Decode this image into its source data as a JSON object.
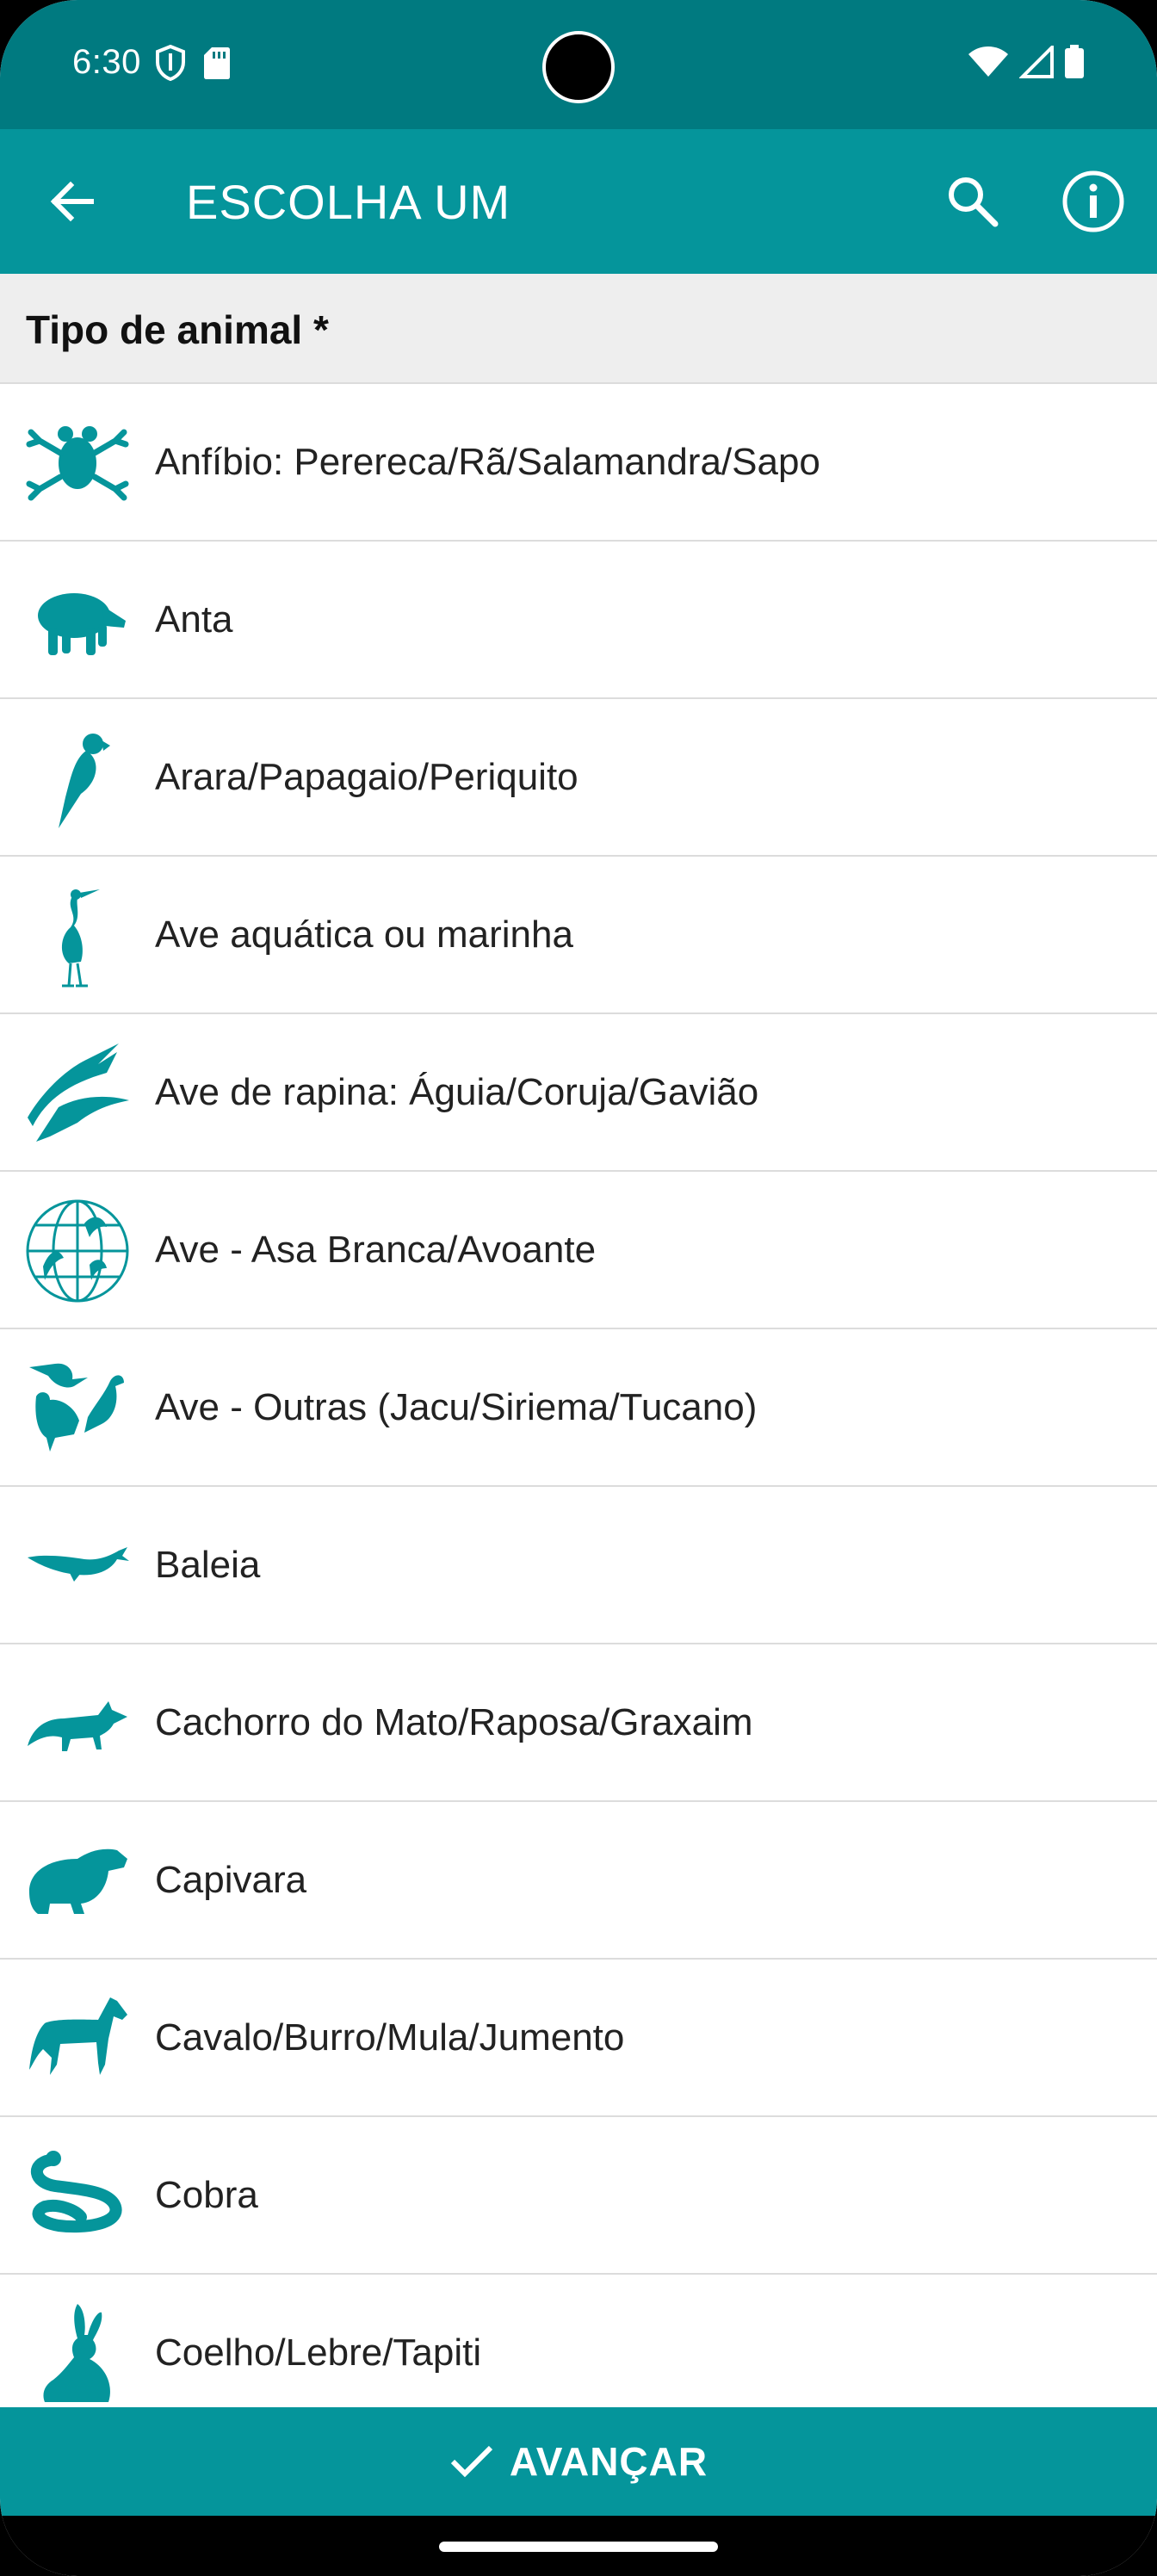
{
  "status_bar": {
    "time": "6:30"
  },
  "app_bar": {
    "title": "ESCOLHA UM"
  },
  "section": {
    "title": "Tipo de animal *"
  },
  "items": [
    {
      "label": "Anfíbio: Perereca/Rã/Salamandra/Sapo",
      "icon": "frog-icon"
    },
    {
      "label": "Anta",
      "icon": "tapir-icon"
    },
    {
      "label": "Arara/Papagaio/Periquito",
      "icon": "parrot-icon"
    },
    {
      "label": "Ave aquática ou marinha",
      "icon": "heron-icon"
    },
    {
      "label": "Ave de rapina: Águia/Coruja/Gavião",
      "icon": "eagle-icon"
    },
    {
      "label": "Ave - Asa Branca/Avoante",
      "icon": "globe-birds-icon"
    },
    {
      "label": "Ave - Outras (Jacu/Siriema/Tucano)",
      "icon": "birds-icon"
    },
    {
      "label": "Baleia",
      "icon": "whale-icon"
    },
    {
      "label": "Cachorro do Mato/Raposa/Graxaim",
      "icon": "fox-icon"
    },
    {
      "label": "Capivara",
      "icon": "capybara-icon"
    },
    {
      "label": "Cavalo/Burro/Mula/Jumento",
      "icon": "horse-icon"
    },
    {
      "label": "Cobra",
      "icon": "snake-icon"
    },
    {
      "label": "Coelho/Lebre/Tapiti",
      "icon": "rabbit-icon"
    }
  ],
  "footer": {
    "advance_label": "AVANÇAR"
  },
  "colors": {
    "status_bar": "#007a80",
    "app_bar": "#05959b",
    "icon": "#05959b",
    "header_bg": "#eeeeee"
  }
}
